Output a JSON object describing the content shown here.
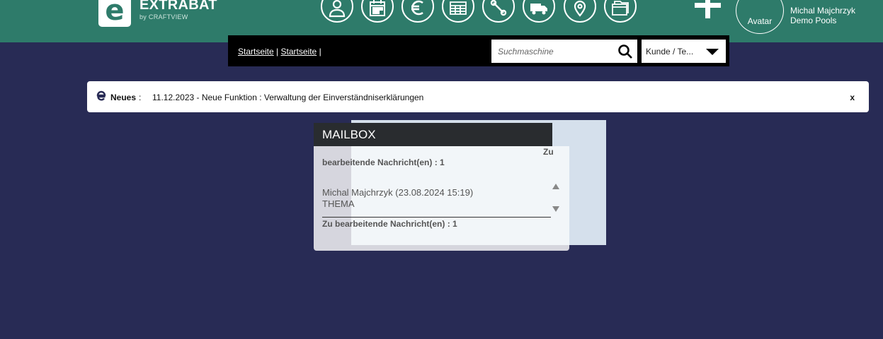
{
  "header": {
    "brand_name": "EXTRABAT",
    "brand_sub": "by CRAFTVIEW",
    "logo_letter": "e",
    "nav_icons": [
      "user-icon",
      "calendar-icon",
      "euro-icon",
      "spreadsheet-icon",
      "tools-icon",
      "truck-icon",
      "location-pin-icon",
      "folders-icon"
    ],
    "avatar_label": "Avatar",
    "user_name": "Michal Majchrzyk",
    "company": "Demo Pools",
    "colors": {
      "header_bg": "#2e7b6a",
      "page_bg": "#282b55"
    }
  },
  "subbar": {
    "crumb1": "Startseite",
    "crumb2": "Startseite",
    "separator": "|",
    "search_placeholder": "Suchmaschine",
    "select_value": "Kunde / Te..."
  },
  "news": {
    "label": "Neues",
    "separator": ":",
    "text": "11.12.2023 - Neue Funktion : Verwaltung der Einverständniserklärungen",
    "close": "x"
  },
  "mailbox": {
    "title": "MAILBOX",
    "zu": "Zu",
    "count_line": "bearbeitende Nachricht(en) : 1",
    "message_from": "Michal Majchrzyk (23.08.2024 15:19)",
    "message_subject": "THEMA",
    "count_footer": "Zu bearbeitende Nachricht(en) : 1"
  }
}
